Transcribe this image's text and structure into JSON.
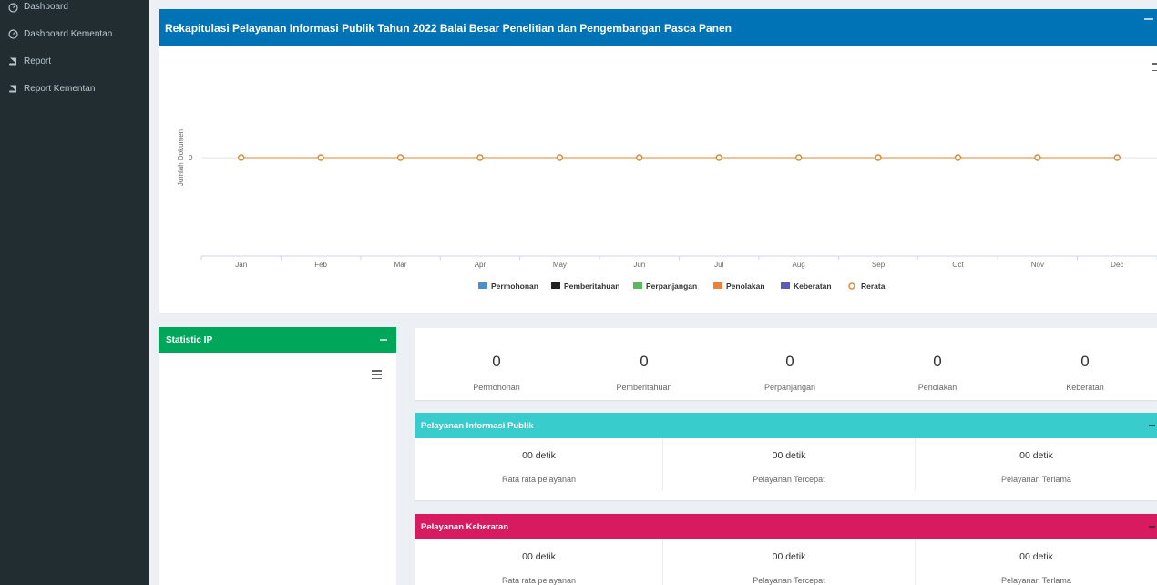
{
  "sidebar": {
    "items": [
      {
        "label": "Dashboard",
        "icon": "dashboard-icon"
      },
      {
        "label": "Dashboard Kementan",
        "icon": "dashboard-icon"
      },
      {
        "label": "Report",
        "icon": "book-icon"
      },
      {
        "label": "Report Kementan",
        "icon": "book-icon"
      }
    ]
  },
  "chart_box": {
    "title": "Rekapitulasi Pelayanan Informasi Publik Tahun 2022 Balai Besar Penelitian dan Pengembangan Pasca Panen",
    "header_color": "#0073b7"
  },
  "chart_data": {
    "type": "bar",
    "categories": [
      "Jan",
      "Feb",
      "Mar",
      "Apr",
      "May",
      "Jun",
      "Jul",
      "Aug",
      "Sep",
      "Oct",
      "Nov",
      "Dec"
    ],
    "series": [
      {
        "name": "Permohonan",
        "color": "#4f8fc9",
        "values": [
          0,
          0,
          0,
          0,
          0,
          0,
          0,
          0,
          0,
          0,
          0,
          0
        ]
      },
      {
        "name": "Pemberitahuan",
        "color": "#222222",
        "values": [
          0,
          0,
          0,
          0,
          0,
          0,
          0,
          0,
          0,
          0,
          0,
          0
        ]
      },
      {
        "name": "Perpanjangan",
        "color": "#5cb85c",
        "values": [
          0,
          0,
          0,
          0,
          0,
          0,
          0,
          0,
          0,
          0,
          0,
          0
        ]
      },
      {
        "name": "Penolakan",
        "color": "#e8823a",
        "values": [
          0,
          0,
          0,
          0,
          0,
          0,
          0,
          0,
          0,
          0,
          0,
          0
        ]
      },
      {
        "name": "Keberatan",
        "color": "#5b5bb8",
        "values": [
          0,
          0,
          0,
          0,
          0,
          0,
          0,
          0,
          0,
          0,
          0,
          0
        ]
      },
      {
        "name": "Rerata",
        "type": "line",
        "color": "#d98a3a",
        "values": [
          0,
          0,
          0,
          0,
          0,
          0,
          0,
          0,
          0,
          0,
          0,
          0
        ]
      }
    ],
    "ylabel": "Jumlah Dokumen",
    "yticks": [
      "0"
    ],
    "legend": "bottom"
  },
  "stat_box": {
    "title": "Statistic IP",
    "header_color": "#00a65a"
  },
  "counts": [
    {
      "value": "0",
      "label": "Permohonan"
    },
    {
      "value": "0",
      "label": "Pemberitahuan"
    },
    {
      "value": "0",
      "label": "Perpanjangan"
    },
    {
      "value": "0",
      "label": "Penolakan"
    },
    {
      "value": "0",
      "label": "Keberatan"
    }
  ],
  "panels": [
    {
      "title": "Pelayanan Informasi Publik",
      "color": "#39cccc",
      "items": [
        {
          "value": "00 detik",
          "label": "Rata rata pelayanan"
        },
        {
          "value": "00 detik",
          "label": "Pelayanan Tercepat"
        },
        {
          "value": "00 detik",
          "label": "Pelayanan Terlama"
        }
      ]
    },
    {
      "title": "Pelayanan Keberatan",
      "color": "#d81b60",
      "items": [
        {
          "value": "00 detik",
          "label": "Rata rata pelayanan"
        },
        {
          "value": "00 detik",
          "label": "Pelayanan Tercepat"
        },
        {
          "value": "00 detik",
          "label": "Pelayanan Terlama"
        }
      ]
    }
  ]
}
